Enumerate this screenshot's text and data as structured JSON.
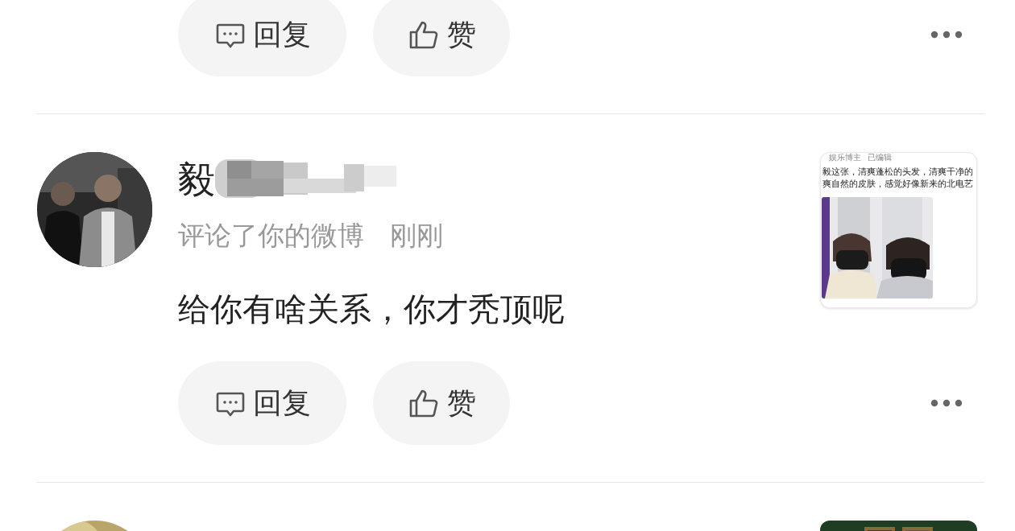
{
  "previous_item": {
    "actions": [
      {
        "kind": "reply",
        "label": "回复"
      },
      {
        "kind": "like",
        "label": "赞"
      }
    ]
  },
  "item": {
    "user": {
      "name": "毅"
    },
    "action_text": "评论了你的微博",
    "time": "刚刚",
    "comment": "给你有啥关系，你才秃顶呢",
    "actions": [
      {
        "kind": "reply",
        "label": "回复"
      },
      {
        "kind": "like",
        "label": "赞"
      }
    ],
    "preview": {
      "author_tag": "娱乐博主",
      "edited": "已编辑",
      "lines": [
        "毅这张，清爽蓬松的头发，清爽干净的",
        "爽自然的皮肤，感觉好像新来的北电艺"
      ]
    }
  }
}
